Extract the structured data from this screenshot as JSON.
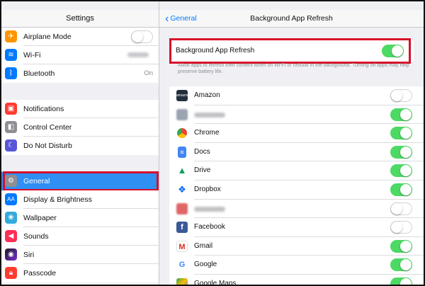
{
  "status_bar": {
    "device": "iPad",
    "time": "",
    "battery_icon": "battery-icon"
  },
  "left_pane": {
    "title": "Settings",
    "group1": [
      {
        "label": "Airplane Mode",
        "icon": "airplane-icon",
        "color": "#ff9500",
        "control": "toggle",
        "on": false
      },
      {
        "label": "Wi-Fi",
        "icon": "wifi-icon",
        "color": "#007aff",
        "control": "blurred-value"
      },
      {
        "label": "Bluetooth",
        "icon": "bluetooth-icon",
        "color": "#007aff",
        "control": "value",
        "value": "On"
      }
    ],
    "group2": [
      {
        "label": "Notifications",
        "icon": "notifications-icon",
        "color": "#ff3b30"
      },
      {
        "label": "Control Center",
        "icon": "control-center-icon",
        "color": "#8e8e93"
      },
      {
        "label": "Do Not Disturb",
        "icon": "moon-icon",
        "color": "#5856d6"
      }
    ],
    "group3": [
      {
        "label": "General",
        "icon": "gear-icon",
        "color": "#8e8e93",
        "selected": true
      },
      {
        "label": "Display & Brightness",
        "icon": "display-icon",
        "color": "#007aff"
      },
      {
        "label": "Wallpaper",
        "icon": "wallpaper-icon",
        "color": "#34aadc"
      },
      {
        "label": "Sounds",
        "icon": "sounds-icon",
        "color": "#ff2d55"
      },
      {
        "label": "Siri",
        "icon": "siri-icon",
        "color": "#1c1c1e"
      },
      {
        "label": "Passcode",
        "icon": "lock-icon",
        "color": "#ff3b30"
      }
    ]
  },
  "right_pane": {
    "back_label": "General",
    "title": "Background App Refresh",
    "main_toggle": {
      "label": "Background App Refresh",
      "on": true
    },
    "footnote": "Allow apps to refresh their content when on Wi-Fi or cellular in the background. Turning off apps may help preserve battery life.",
    "apps": [
      {
        "label": "Amazon",
        "icon": "amazon-icon",
        "color": "#232f3e",
        "on": false
      },
      {
        "label": "",
        "icon": "blurred-app-icon",
        "color": "#9aa4b1",
        "on": true,
        "blurred": true
      },
      {
        "label": "Chrome",
        "icon": "chrome-icon",
        "color": "#ffffff",
        "on": true
      },
      {
        "label": "Docs",
        "icon": "docs-icon",
        "color": "#4285f4",
        "on": true
      },
      {
        "label": "Drive",
        "icon": "drive-icon",
        "color": "#ffffff",
        "on": true
      },
      {
        "label": "Dropbox",
        "icon": "dropbox-icon",
        "color": "#0061fe",
        "on": true
      },
      {
        "label": "",
        "icon": "blurred-app-icon",
        "color": "#e06666",
        "on": false,
        "blurred": true
      },
      {
        "label": "Facebook",
        "icon": "facebook-icon",
        "color": "#3b5998",
        "on": false
      },
      {
        "label": "Gmail",
        "icon": "gmail-icon",
        "color": "#ffffff",
        "on": true
      },
      {
        "label": "Google",
        "icon": "google-icon",
        "color": "#ffffff",
        "on": true
      },
      {
        "label": "Google Maps",
        "icon": "google-maps-icon",
        "color": "#34a853",
        "on": true
      }
    ]
  },
  "colors": {
    "accent": "#007aff",
    "toggle_on": "#4cd964",
    "highlight": "#d7102a",
    "selected": "#2f8ff3"
  }
}
